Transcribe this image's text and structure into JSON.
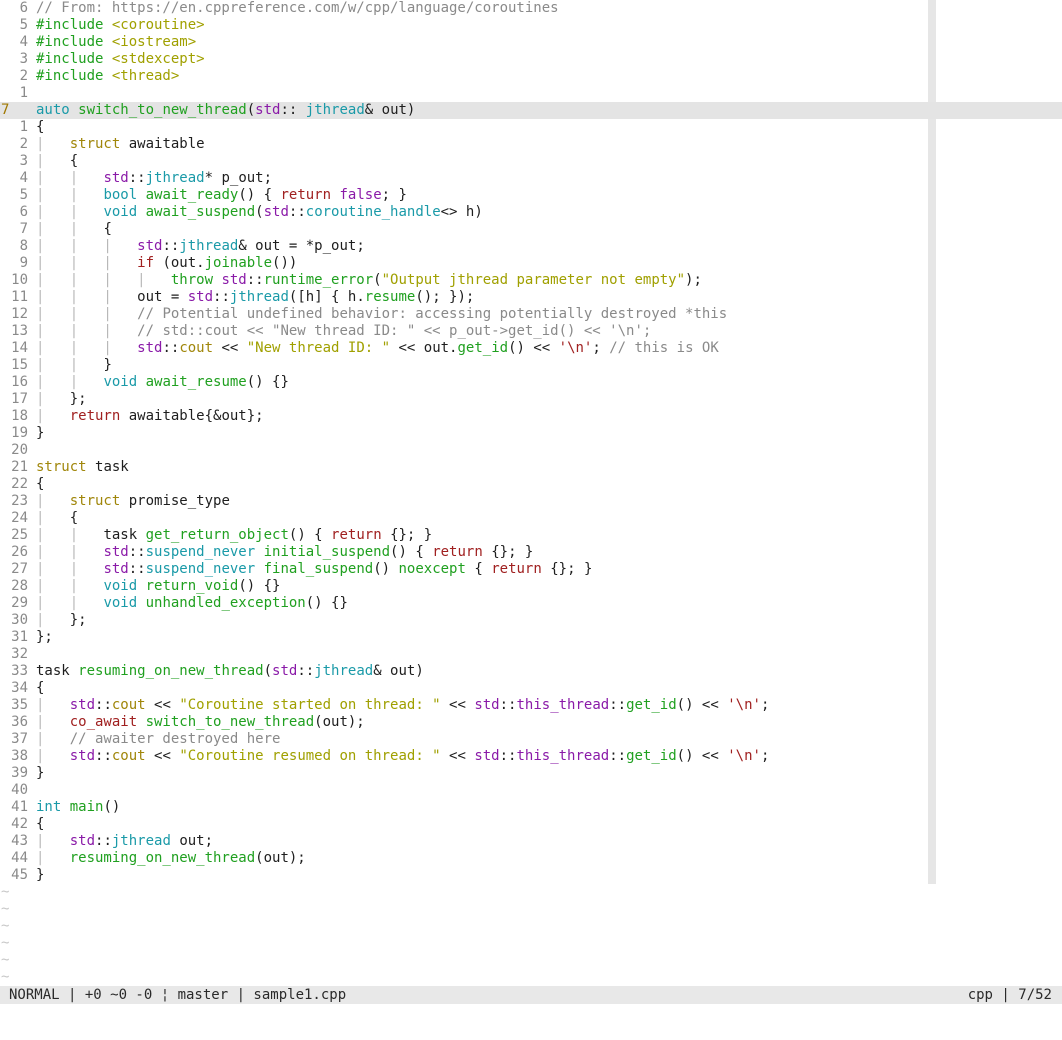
{
  "editor": {
    "file": "sample1.cpp",
    "lines": [
      {
        "num": "6",
        "current": false,
        "tokens": [
          [
            "c",
            "// From: https://en.cppreference.com/w/cpp/language/coroutines"
          ]
        ]
      },
      {
        "num": "5",
        "current": false,
        "tokens": [
          [
            "f",
            "#include "
          ],
          [
            "s",
            "<coroutine>"
          ]
        ]
      },
      {
        "num": "4",
        "current": false,
        "tokens": [
          [
            "f",
            "#include "
          ],
          [
            "s",
            "<iostream>"
          ]
        ]
      },
      {
        "num": "3",
        "current": false,
        "tokens": [
          [
            "f",
            "#include "
          ],
          [
            "s",
            "<stdexcept>"
          ]
        ]
      },
      {
        "num": "2",
        "current": false,
        "tokens": [
          [
            "f",
            "#include "
          ],
          [
            "s",
            "<thread>"
          ]
        ]
      },
      {
        "num": "1",
        "current": false,
        "tokens": []
      },
      {
        "num": "7",
        "current": true,
        "tokens": [
          [
            "ty",
            "auto "
          ],
          [
            "f",
            "switch_to_new_thread"
          ],
          [
            "",
            "("
          ],
          [
            "ns",
            "std"
          ],
          [
            "",
            ":: "
          ],
          [
            "ty",
            "jthread"
          ],
          [
            "",
            "& out)"
          ]
        ]
      },
      {
        "num": "1",
        "current": false,
        "tokens": [
          [
            "",
            "{"
          ]
        ]
      },
      {
        "num": "2",
        "current": false,
        "tokens": [
          [
            "g",
            "|   "
          ],
          [
            "k",
            "struct "
          ],
          [
            "",
            "awaitable"
          ]
        ]
      },
      {
        "num": "3",
        "current": false,
        "tokens": [
          [
            "g",
            "|   "
          ],
          [
            "",
            "{"
          ]
        ]
      },
      {
        "num": "4",
        "current": false,
        "tokens": [
          [
            "g",
            "|   |   "
          ],
          [
            "ns",
            "std"
          ],
          [
            "",
            "::"
          ],
          [
            "ty",
            "jthread"
          ],
          [
            "",
            "* p_out;"
          ]
        ]
      },
      {
        "num": "5",
        "current": false,
        "tokens": [
          [
            "g",
            "|   |   "
          ],
          [
            "ty",
            "bool "
          ],
          [
            "f",
            "await_ready"
          ],
          [
            "",
            "() { "
          ],
          [
            "r",
            "return "
          ],
          [
            "ns",
            "false"
          ],
          [
            "",
            "; }"
          ]
        ]
      },
      {
        "num": "6",
        "current": false,
        "tokens": [
          [
            "g",
            "|   |   "
          ],
          [
            "ty",
            "void "
          ],
          [
            "f",
            "await_suspend"
          ],
          [
            "",
            "("
          ],
          [
            "ns",
            "std"
          ],
          [
            "",
            "::"
          ],
          [
            "ty",
            "coroutine_handle"
          ],
          [
            "",
            "<> h)"
          ]
        ]
      },
      {
        "num": "7",
        "current": false,
        "tokens": [
          [
            "g",
            "|   |   "
          ],
          [
            "",
            "{"
          ]
        ]
      },
      {
        "num": "8",
        "current": false,
        "tokens": [
          [
            "g",
            "|   |   |   "
          ],
          [
            "ns",
            "std"
          ],
          [
            "",
            "::"
          ],
          [
            "ty",
            "jthread"
          ],
          [
            "",
            "& out = *p_out;"
          ]
        ]
      },
      {
        "num": "9",
        "current": false,
        "tokens": [
          [
            "g",
            "|   |   |   "
          ],
          [
            "r",
            "if "
          ],
          [
            "",
            "(out."
          ],
          [
            "f",
            "joinable"
          ],
          [
            "",
            "())"
          ]
        ]
      },
      {
        "num": "10",
        "current": false,
        "tokens": [
          [
            "g",
            "|   |   |   |   "
          ],
          [
            "f",
            "throw "
          ],
          [
            "ns",
            "std"
          ],
          [
            "",
            "::"
          ],
          [
            "f",
            "runtime_error"
          ],
          [
            "",
            "("
          ],
          [
            "s",
            "\"Output jthread parameter not empty\""
          ],
          [
            "",
            ");"
          ]
        ]
      },
      {
        "num": "11",
        "current": false,
        "tokens": [
          [
            "g",
            "|   |   |   "
          ],
          [
            "",
            "out = "
          ],
          [
            "ns",
            "std"
          ],
          [
            "",
            "::"
          ],
          [
            "ty",
            "jthread"
          ],
          [
            "",
            "([h] { h."
          ],
          [
            "f",
            "resume"
          ],
          [
            "",
            "(); });"
          ]
        ]
      },
      {
        "num": "12",
        "current": false,
        "tokens": [
          [
            "g",
            "|   |   |   "
          ],
          [
            "c",
            "// Potential undefined behavior: accessing potentially destroyed *this"
          ]
        ]
      },
      {
        "num": "13",
        "current": false,
        "tokens": [
          [
            "g",
            "|   |   |   "
          ],
          [
            "c",
            "// std::cout << \"New thread ID: \" << p_out->get_id() << '\\n';"
          ]
        ]
      },
      {
        "num": "14",
        "current": false,
        "tokens": [
          [
            "g",
            "|   |   |   "
          ],
          [
            "ns",
            "std"
          ],
          [
            "",
            "::"
          ],
          [
            "k",
            "cout"
          ],
          [
            "",
            " << "
          ],
          [
            "s",
            "\"New thread ID: \""
          ],
          [
            "",
            " << out."
          ],
          [
            "f",
            "get_id"
          ],
          [
            "",
            "() << "
          ],
          [
            "r",
            "'\\n'"
          ],
          [
            "",
            "; "
          ],
          [
            "c",
            "// this is OK"
          ]
        ]
      },
      {
        "num": "15",
        "current": false,
        "tokens": [
          [
            "g",
            "|   |   "
          ],
          [
            "",
            "}"
          ]
        ]
      },
      {
        "num": "16",
        "current": false,
        "tokens": [
          [
            "g",
            "|   |   "
          ],
          [
            "ty",
            "void "
          ],
          [
            "f",
            "await_resume"
          ],
          [
            "",
            "() {}"
          ]
        ]
      },
      {
        "num": "17",
        "current": false,
        "tokens": [
          [
            "g",
            "|   "
          ],
          [
            "",
            "};"
          ]
        ]
      },
      {
        "num": "18",
        "current": false,
        "tokens": [
          [
            "g",
            "|   "
          ],
          [
            "r",
            "return "
          ],
          [
            "",
            "awaitable{&out};"
          ]
        ]
      },
      {
        "num": "19",
        "current": false,
        "tokens": [
          [
            "",
            "}"
          ]
        ]
      },
      {
        "num": "20",
        "current": false,
        "tokens": []
      },
      {
        "num": "21",
        "current": false,
        "tokens": [
          [
            "k",
            "struct "
          ],
          [
            "",
            "task"
          ]
        ]
      },
      {
        "num": "22",
        "current": false,
        "tokens": [
          [
            "",
            "{"
          ]
        ]
      },
      {
        "num": "23",
        "current": false,
        "tokens": [
          [
            "g",
            "|   "
          ],
          [
            "k",
            "struct "
          ],
          [
            "",
            "promise_type"
          ]
        ]
      },
      {
        "num": "24",
        "current": false,
        "tokens": [
          [
            "g",
            "|   "
          ],
          [
            "",
            "{"
          ]
        ]
      },
      {
        "num": "25",
        "current": false,
        "tokens": [
          [
            "g",
            "|   |   "
          ],
          [
            "",
            "task "
          ],
          [
            "f",
            "get_return_object"
          ],
          [
            "",
            "() { "
          ],
          [
            "r",
            "return "
          ],
          [
            "",
            "{}; }"
          ]
        ]
      },
      {
        "num": "26",
        "current": false,
        "tokens": [
          [
            "g",
            "|   |   "
          ],
          [
            "ns",
            "std"
          ],
          [
            "",
            "::"
          ],
          [
            "ty",
            "suspend_never "
          ],
          [
            "f",
            "initial_suspend"
          ],
          [
            "",
            "() { "
          ],
          [
            "r",
            "return "
          ],
          [
            "",
            "{}; }"
          ]
        ]
      },
      {
        "num": "27",
        "current": false,
        "tokens": [
          [
            "g",
            "|   |   "
          ],
          [
            "ns",
            "std"
          ],
          [
            "",
            "::"
          ],
          [
            "ty",
            "suspend_never "
          ],
          [
            "f",
            "final_suspend"
          ],
          [
            "",
            "() "
          ],
          [
            "f",
            "noexcept"
          ],
          [
            "",
            " { "
          ],
          [
            "r",
            "return "
          ],
          [
            "",
            "{}; }"
          ]
        ]
      },
      {
        "num": "28",
        "current": false,
        "tokens": [
          [
            "g",
            "|   |   "
          ],
          [
            "ty",
            "void "
          ],
          [
            "f",
            "return_void"
          ],
          [
            "",
            "() {}"
          ]
        ]
      },
      {
        "num": "29",
        "current": false,
        "tokens": [
          [
            "g",
            "|   |   "
          ],
          [
            "ty",
            "void "
          ],
          [
            "f",
            "unhandled_exception"
          ],
          [
            "",
            "() {}"
          ]
        ]
      },
      {
        "num": "30",
        "current": false,
        "tokens": [
          [
            "g",
            "|   "
          ],
          [
            "",
            "};"
          ]
        ]
      },
      {
        "num": "31",
        "current": false,
        "tokens": [
          [
            "",
            "};"
          ]
        ]
      },
      {
        "num": "32",
        "current": false,
        "tokens": []
      },
      {
        "num": "33",
        "current": false,
        "tokens": [
          [
            "",
            "task "
          ],
          [
            "f",
            "resuming_on_new_thread"
          ],
          [
            "",
            "("
          ],
          [
            "ns",
            "std"
          ],
          [
            "",
            "::"
          ],
          [
            "ty",
            "jthread"
          ],
          [
            "",
            "& out)"
          ]
        ]
      },
      {
        "num": "34",
        "current": false,
        "tokens": [
          [
            "",
            "{"
          ]
        ]
      },
      {
        "num": "35",
        "current": false,
        "tokens": [
          [
            "g",
            "|   "
          ],
          [
            "ns",
            "std"
          ],
          [
            "",
            "::"
          ],
          [
            "k",
            "cout"
          ],
          [
            "",
            " << "
          ],
          [
            "s",
            "\"Coroutine started on thread: \""
          ],
          [
            "",
            " << "
          ],
          [
            "ns",
            "std"
          ],
          [
            "",
            "::"
          ],
          [
            "ns",
            "this_thread"
          ],
          [
            "",
            "::"
          ],
          [
            "f",
            "get_id"
          ],
          [
            "",
            "() << "
          ],
          [
            "r",
            "'\\n'"
          ],
          [
            "",
            ";"
          ]
        ]
      },
      {
        "num": "36",
        "current": false,
        "tokens": [
          [
            "g",
            "|   "
          ],
          [
            "r",
            "co_await "
          ],
          [
            "f",
            "switch_to_new_thread"
          ],
          [
            "",
            "(out);"
          ]
        ]
      },
      {
        "num": "37",
        "current": false,
        "tokens": [
          [
            "g",
            "|   "
          ],
          [
            "c",
            "// awaiter destroyed here"
          ]
        ]
      },
      {
        "num": "38",
        "current": false,
        "tokens": [
          [
            "g",
            "|   "
          ],
          [
            "ns",
            "std"
          ],
          [
            "",
            "::"
          ],
          [
            "k",
            "cout"
          ],
          [
            "",
            " << "
          ],
          [
            "s",
            "\"Coroutine resumed on thread: \""
          ],
          [
            "",
            " << "
          ],
          [
            "ns",
            "std"
          ],
          [
            "",
            "::"
          ],
          [
            "ns",
            "this_thread"
          ],
          [
            "",
            "::"
          ],
          [
            "f",
            "get_id"
          ],
          [
            "",
            "() << "
          ],
          [
            "r",
            "'\\n'"
          ],
          [
            "",
            ";"
          ]
        ]
      },
      {
        "num": "39",
        "current": false,
        "tokens": [
          [
            "",
            "}"
          ]
        ]
      },
      {
        "num": "40",
        "current": false,
        "tokens": []
      },
      {
        "num": "41",
        "current": false,
        "tokens": [
          [
            "ty",
            "int "
          ],
          [
            "f",
            "main"
          ],
          [
            "",
            "()"
          ]
        ]
      },
      {
        "num": "42",
        "current": false,
        "tokens": [
          [
            "",
            "{"
          ]
        ]
      },
      {
        "num": "43",
        "current": false,
        "tokens": [
          [
            "g",
            "|   "
          ],
          [
            "ns",
            "std"
          ],
          [
            "",
            "::"
          ],
          [
            "ty",
            "jthread"
          ],
          [
            "",
            " out;"
          ]
        ]
      },
      {
        "num": "44",
        "current": false,
        "tokens": [
          [
            "g",
            "|   "
          ],
          [
            "f",
            "resuming_on_new_thread"
          ],
          [
            "",
            "(out);"
          ]
        ]
      },
      {
        "num": "45",
        "current": false,
        "tokens": [
          [
            "",
            "}"
          ]
        ]
      }
    ],
    "empty_line_markers": [
      "~",
      "~",
      "~",
      "~",
      "~",
      "~"
    ]
  },
  "statusbar": {
    "left": "NORMAL | +0 ~0 -0 ¦ master | sample1.cpp",
    "right": "cpp | 7/52"
  }
}
